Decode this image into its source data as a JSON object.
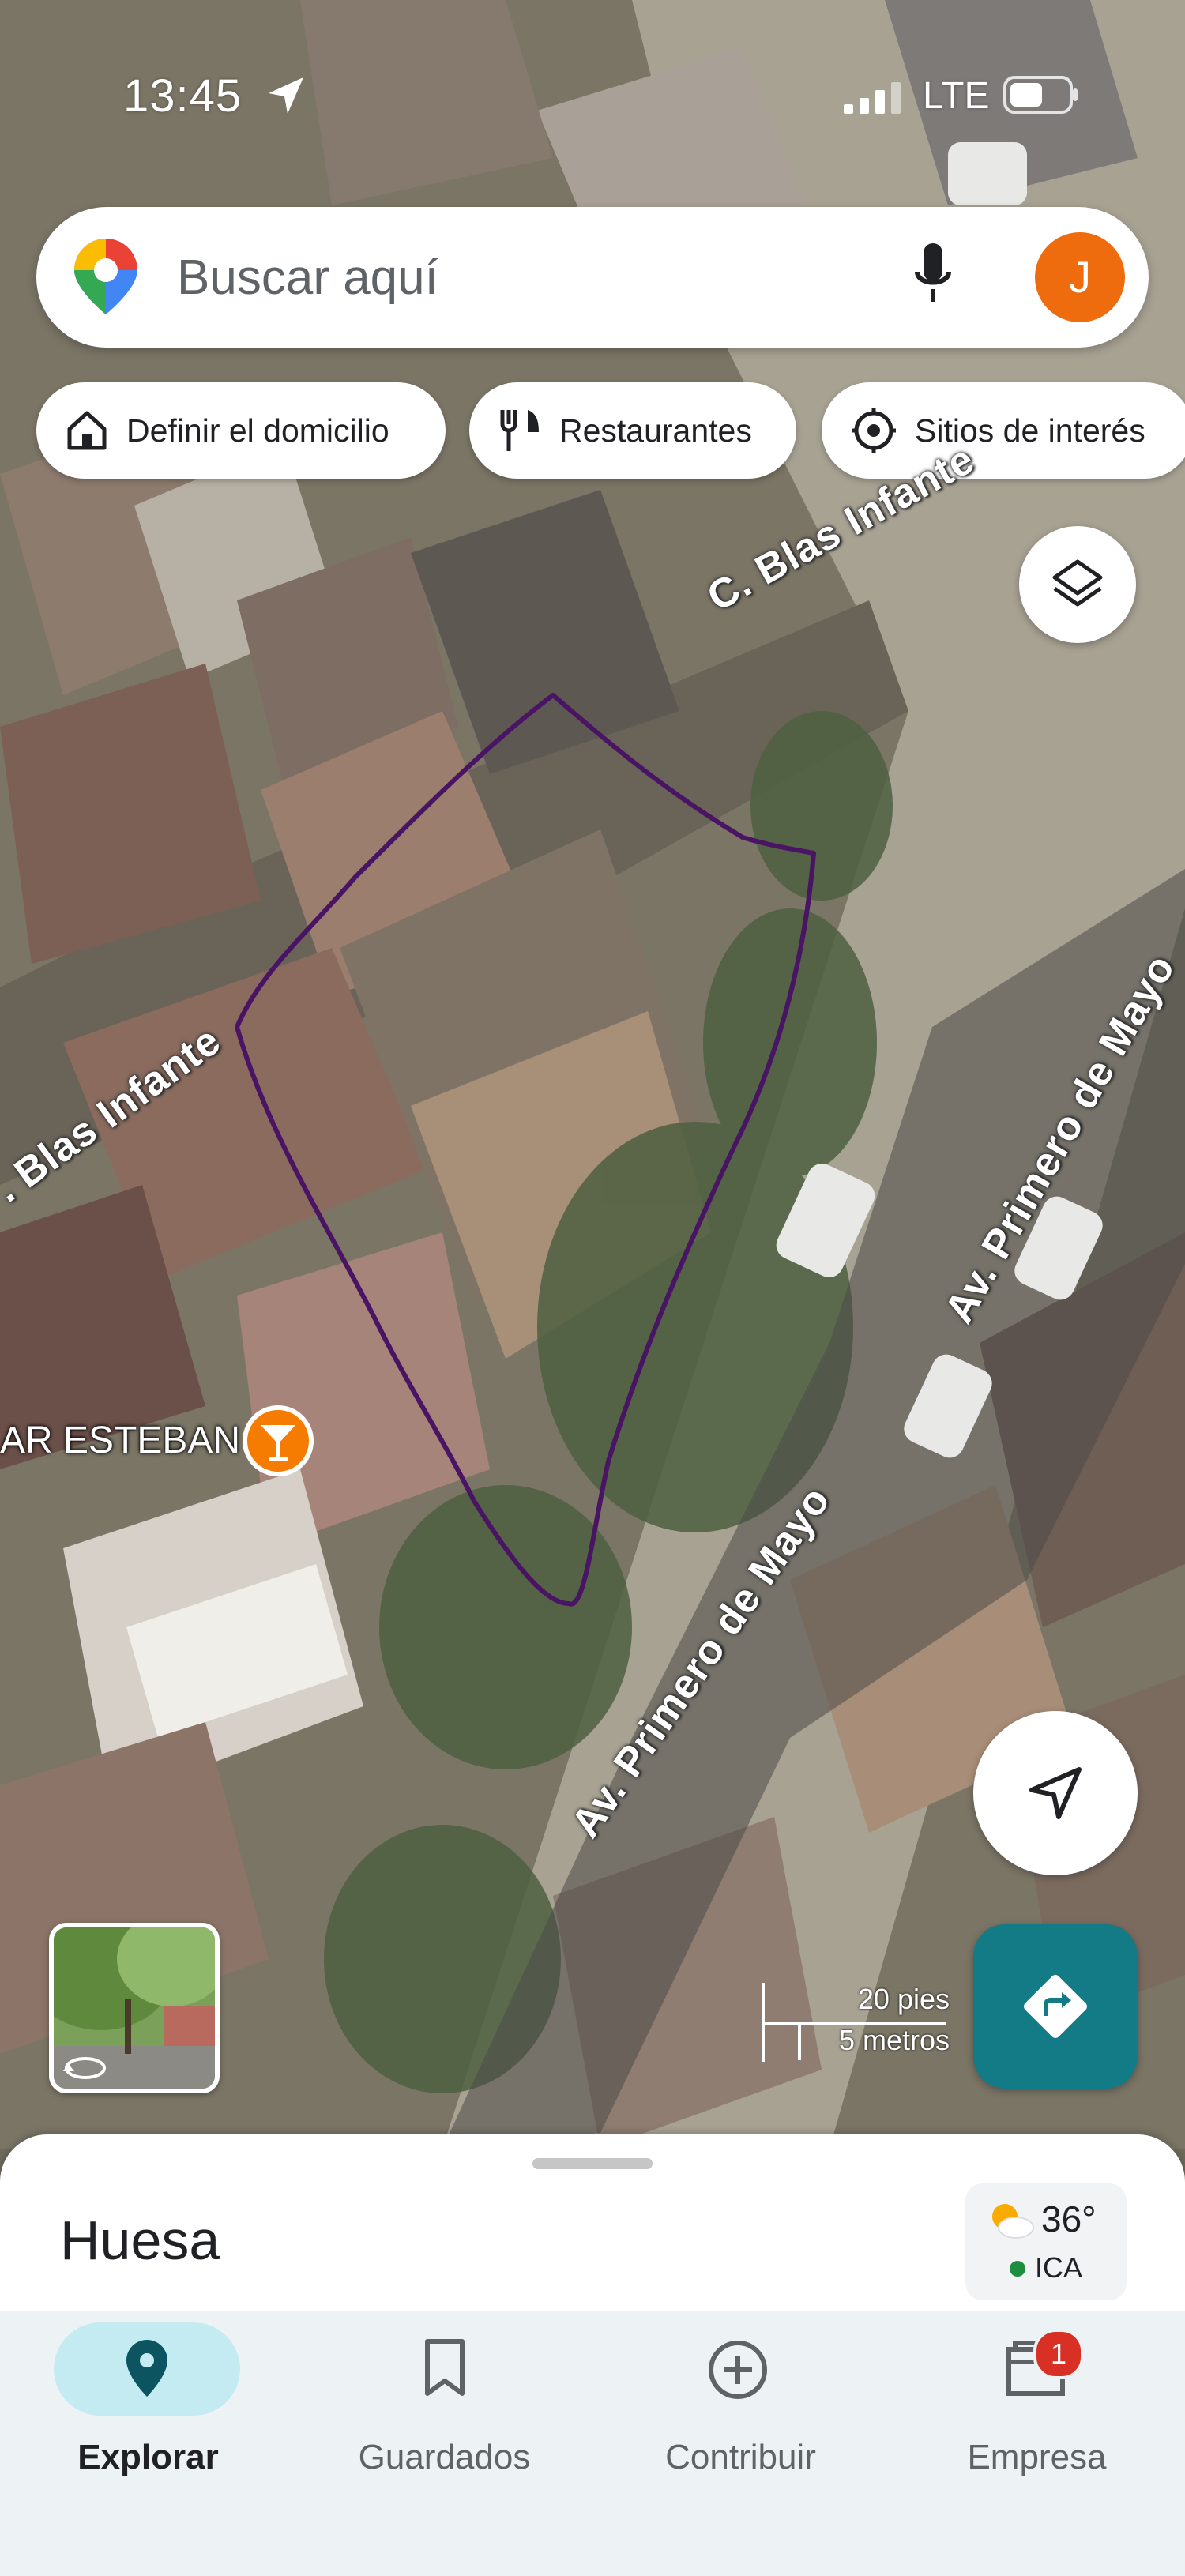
{
  "status": {
    "time": "13:45",
    "network": "LTE"
  },
  "search": {
    "placeholder": "Buscar aquí",
    "avatar_letter": "J"
  },
  "chips": [
    {
      "label": "Definir el domicilio",
      "icon": "home-icon"
    },
    {
      "label": "Restaurantes",
      "icon": "fork-knife-icon"
    },
    {
      "label": "Sitios de interés",
      "icon": "landmark-icon"
    }
  ],
  "map": {
    "roads": [
      "C. Blas Infante",
      ". Blas Infante",
      "Av. Primero de Mayo",
      "Av. Primero de Mayo"
    ],
    "poi": {
      "label": "AR ESTEBAN",
      "icon": "cocktail-icon",
      "color": "#f57c00"
    },
    "scale": {
      "feet": "20 pies",
      "meters": "5 metros"
    },
    "drawn_outline_color": "#4a1464"
  },
  "sheet": {
    "title": "Huesa"
  },
  "weather": {
    "temp": "36°",
    "air_quality": "ICA",
    "aq_color": "#1e8e3e"
  },
  "bottom_nav": [
    {
      "label": "Explorar",
      "icon": "location-pin-icon",
      "active": true
    },
    {
      "label": "Guardados",
      "icon": "bookmark-icon",
      "active": false
    },
    {
      "label": "Contribuir",
      "icon": "add-circle-icon",
      "active": false
    },
    {
      "label": "Empresa",
      "icon": "storefront-icon",
      "active": false,
      "badge": "1"
    }
  ],
  "colors": {
    "accent": "#137b86",
    "active_pill": "#c5ebf2"
  }
}
